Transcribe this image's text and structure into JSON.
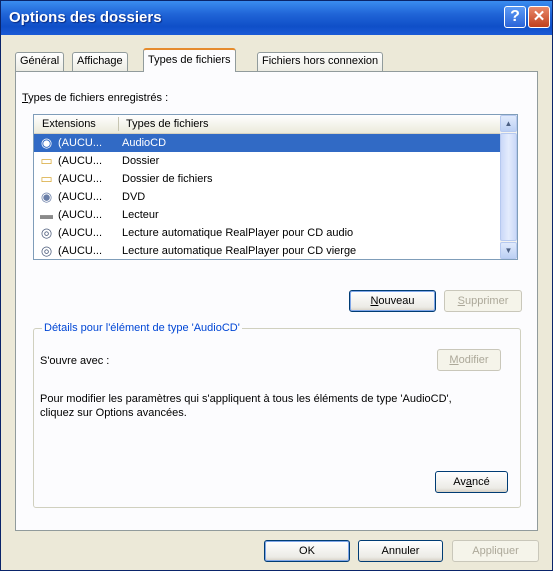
{
  "window": {
    "title": "Options des dossiers",
    "help_label": "?",
    "close_label": "✕"
  },
  "tabs": [
    {
      "label": "Général"
    },
    {
      "label": "Affichage"
    },
    {
      "label": "Types de fichiers"
    },
    {
      "label": "Fichiers hors connexion"
    }
  ],
  "active_tab": "Types de fichiers",
  "registered": {
    "label_prefix": "T",
    "label_rest": "ypes de fichiers enregistrés :",
    "columns": {
      "extensions": "Extensions",
      "types": "Types de fichiers"
    },
    "rows": [
      {
        "icon": "audio-cd-icon",
        "glyph": "◉",
        "ext": "(AUCU...",
        "type": "AudioCD",
        "selected": true
      },
      {
        "icon": "folder-icon",
        "glyph": "▭",
        "ext": "(AUCU...",
        "type": "Dossier"
      },
      {
        "icon": "folder-icon",
        "glyph": "▭",
        "ext": "(AUCU...",
        "type": "Dossier de fichiers"
      },
      {
        "icon": "dvd-icon",
        "glyph": "◉",
        "ext": "(AUCU...",
        "type": "DVD"
      },
      {
        "icon": "drive-icon",
        "glyph": "▬",
        "ext": "(AUCU...",
        "type": "Lecteur"
      },
      {
        "icon": "realplayer-icon",
        "glyph": "◎",
        "ext": "(AUCU...",
        "type": "Lecture automatique RealPlayer pour CD audio"
      },
      {
        "icon": "realplayer-icon",
        "glyph": "◎",
        "ext": "(AUCU...",
        "type": "Lecture automatique RealPlayer pour CD vierge"
      }
    ]
  },
  "buttons": {
    "new_prefix": "N",
    "new_rest": "ouveau",
    "delete_prefix": "S",
    "delete_rest": "upprimer",
    "modify_prefix": "M",
    "modify_rest": "odifier",
    "advanced_prefix": "Av",
    "advanced_u": "a",
    "advanced_rest": "ncé",
    "ok": "OK",
    "cancel": "Annuler",
    "apply": "Appliquer"
  },
  "details": {
    "legend": "Détails pour l'élément de type 'AudioCD'",
    "opens_with": "S'ouvre avec :",
    "description_line1": "Pour modifier les paramètres qui s'appliquent à tous les éléments de type 'AudioCD',",
    "description_line2": "cliquez sur Options avancées."
  },
  "colors": {
    "selection": "#316ac5",
    "titlebar": "#1f63d6",
    "tab_highlight": "#e68b2c",
    "group_legend": "#0046d5"
  }
}
